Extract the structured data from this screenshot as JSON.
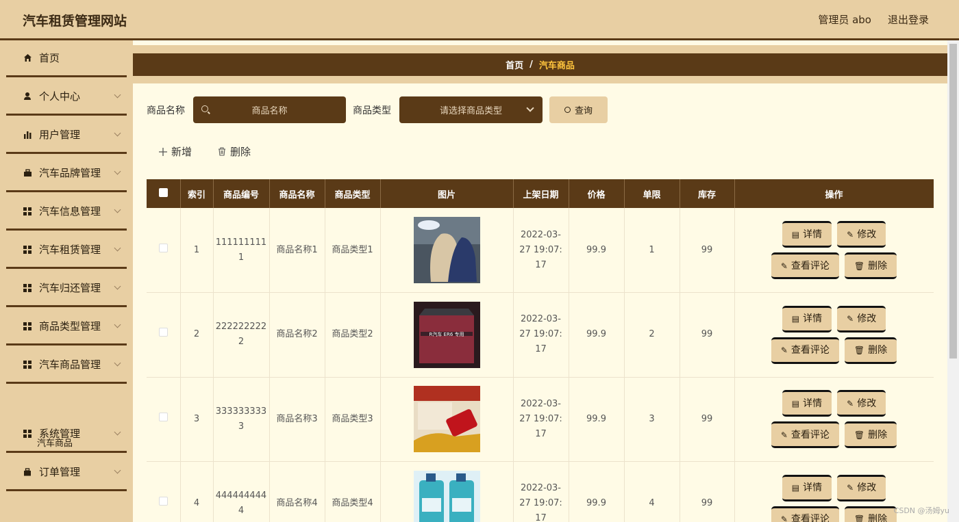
{
  "header": {
    "title": "汽车租赁管理网站",
    "admin_label": "管理员 abo",
    "logout_label": "退出登录"
  },
  "sidebar": {
    "items": [
      {
        "label": "首页",
        "icon": "home-icon",
        "has_arrow": false
      },
      {
        "label": "个人中心",
        "icon": "user-icon",
        "has_arrow": true
      },
      {
        "label": "用户管理",
        "icon": "bar-chart-icon",
        "has_arrow": true
      },
      {
        "label": "汽车品牌管理",
        "icon": "briefcase-icon",
        "has_arrow": true
      },
      {
        "label": "汽车信息管理",
        "icon": "grid-icon",
        "has_arrow": true
      },
      {
        "label": "汽车租赁管理",
        "icon": "grid-icon",
        "has_arrow": true
      },
      {
        "label": "汽车归还管理",
        "icon": "grid-icon",
        "has_arrow": true
      },
      {
        "label": "商品类型管理",
        "icon": "grid-icon",
        "has_arrow": true
      },
      {
        "label": "汽车商品管理",
        "icon": "grid-icon",
        "has_arrow": true
      },
      {
        "label": "系统管理",
        "icon": "grid-icon",
        "has_arrow": true
      },
      {
        "label": "订单管理",
        "icon": "bag-icon",
        "has_arrow": true
      }
    ],
    "sub_item": "汽车商品"
  },
  "breadcrumb": {
    "home": "首页",
    "separator": "/",
    "current": "汽车商品"
  },
  "search": {
    "name_label": "商品名称",
    "name_placeholder": "商品名称",
    "type_label": "商品类型",
    "type_placeholder": "请选择商品类型",
    "query_label": "查询"
  },
  "actions": {
    "add_label": "新增",
    "delete_label": "删除"
  },
  "table": {
    "headers": [
      "索引",
      "商品编号",
      "商品名称",
      "商品类型",
      "图片",
      "上架日期",
      "价格",
      "单限",
      "库存",
      "操作"
    ],
    "rows": [
      {
        "index": "1",
        "code": "1111111111",
        "name": "商品名称1",
        "type": "商品类型1",
        "image": "car-seat-cushion",
        "date": "2022-03-27 19:07:17",
        "price": "99.9",
        "limit": "1",
        "stock": "99"
      },
      {
        "index": "2",
        "code": "2222222222",
        "name": "商品名称2",
        "type": "商品类型2",
        "image": "car-floor-mat",
        "date": "2022-03-27 19:07:17",
        "price": "99.9",
        "limit": "2",
        "stock": "99"
      },
      {
        "index": "3",
        "code": "3333333333",
        "name": "商品名称3",
        "type": "商品类型3",
        "image": "car-air-freshener",
        "date": "2022-03-27 19:07:17",
        "price": "99.9",
        "limit": "3",
        "stock": "99"
      },
      {
        "index": "4",
        "code": "4444444444",
        "name": "商品名称4",
        "type": "商品类型4",
        "image": "washer-fluid",
        "date": "2022-03-27 19:07:17",
        "price": "99.9",
        "limit": "4",
        "stock": "99"
      }
    ],
    "op_labels": {
      "detail": "详情",
      "edit": "修改",
      "reviews": "查看评论",
      "delete": "删除"
    }
  },
  "watermark": "CSDN @汤姆yu",
  "colors": {
    "primary": "#5a3a17",
    "accent": "#e8cfa3",
    "background": "#fffbe6",
    "highlight": "#ffc53d"
  }
}
